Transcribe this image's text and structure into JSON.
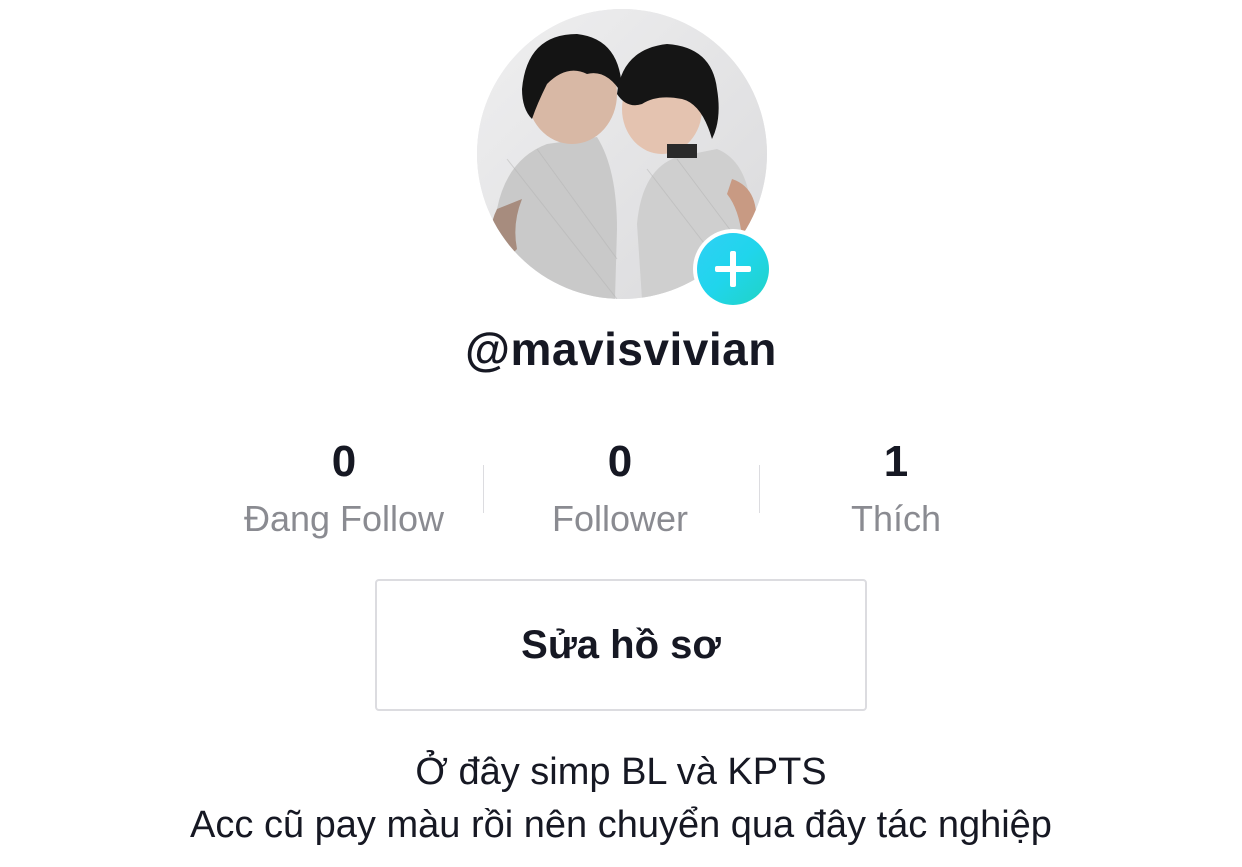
{
  "profile": {
    "avatar_alt": "Profile photo",
    "add_icon": "plus-icon",
    "username": "@mavisvivian"
  },
  "stats": [
    {
      "value": "0",
      "label": "Đang Follow"
    },
    {
      "value": "0",
      "label": "Follower"
    },
    {
      "value": "1",
      "label": "Thích"
    }
  ],
  "actions": {
    "edit_profile_label": "Sửa hồ sơ"
  },
  "bio": {
    "line1": "Ở đây simp BL và KPTS",
    "line2": "Acc cũ pay màu rồi nên chuyển qua đây tác nghiệp"
  },
  "colors": {
    "accent_badge": "#20d5ec",
    "text_primary": "#161823",
    "text_secondary": "#8a8b91",
    "border": "#dcdce0"
  }
}
